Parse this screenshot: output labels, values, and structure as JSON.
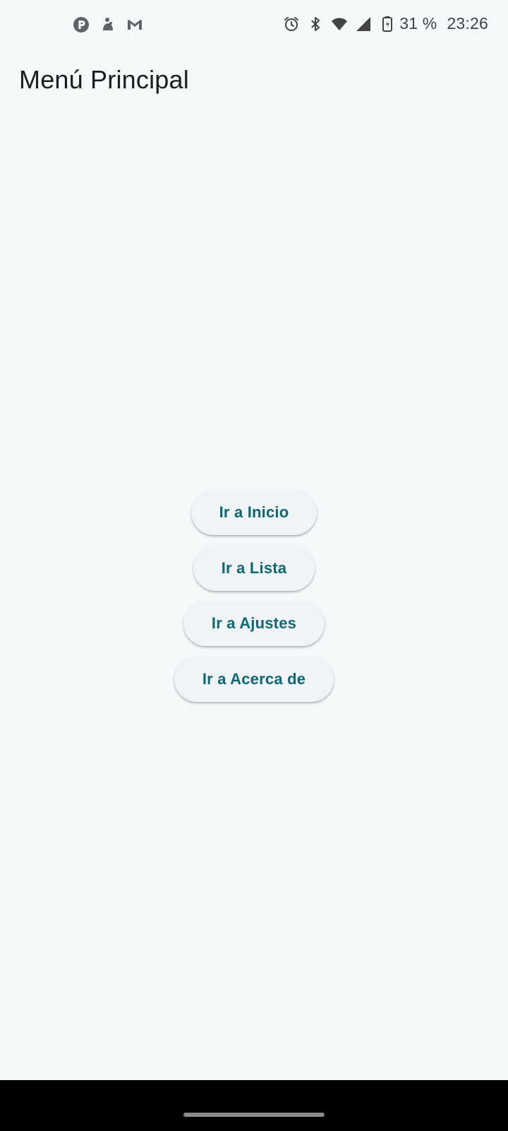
{
  "status_bar": {
    "left_icons": [
      "p-badge-icon",
      "figure-icon",
      "gmail-icon"
    ],
    "right_icons": [
      "alarm-icon",
      "bluetooth-icon",
      "wifi-icon",
      "signal-icon",
      "battery-charging-icon"
    ],
    "battery": "31 %",
    "time": "23:26"
  },
  "header": {
    "title": "Menú Principal"
  },
  "menu": {
    "buttons": [
      {
        "label": "Ir a Inicio"
      },
      {
        "label": "Ir a Lista"
      },
      {
        "label": "Ir a Ajustes"
      },
      {
        "label": "Ir a Acerca de"
      }
    ]
  },
  "colors": {
    "background": "#f4f9fa",
    "button_bg": "#f0f4f6",
    "button_text": "#0d6775"
  }
}
